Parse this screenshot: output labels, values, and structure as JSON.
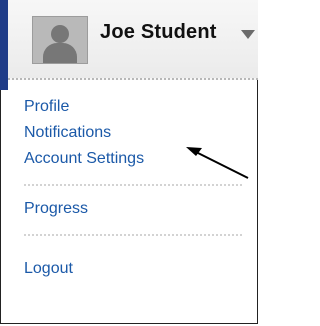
{
  "user": {
    "name": "Joe Student"
  },
  "menu": {
    "items": [
      {
        "label": "Profile"
      },
      {
        "label": "Notifications"
      },
      {
        "label": "Account Settings"
      },
      {
        "label": "Progress"
      },
      {
        "label": "Logout"
      }
    ]
  },
  "colors": {
    "link": "#1b59a8",
    "accent": "#1f3c88"
  },
  "icons": {
    "avatar": "user-silhouette-icon",
    "dropdown": "caret-down-icon",
    "annotation": "arrow-icon"
  }
}
